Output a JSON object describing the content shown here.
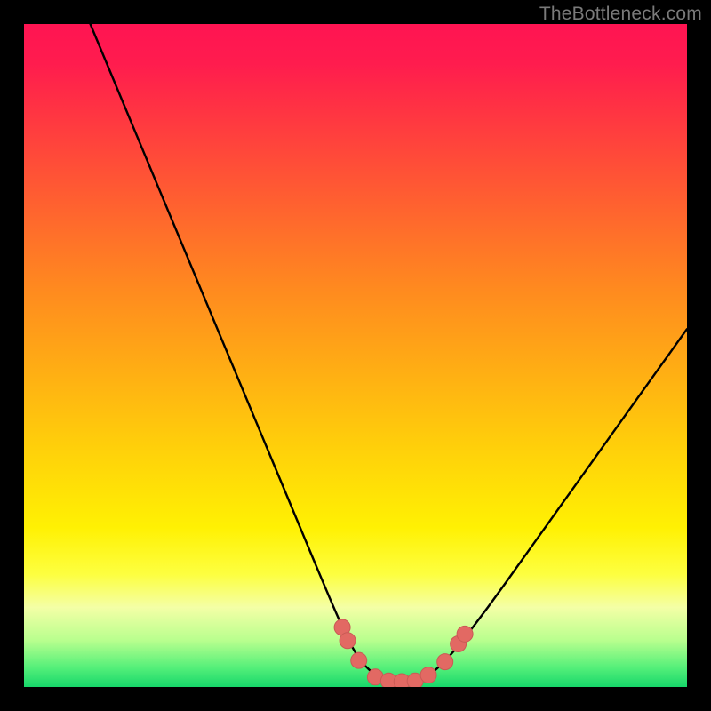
{
  "watermark": "TheBottleneck.com",
  "colors": {
    "frame": "#000000",
    "curve": "#000000",
    "pointFill": "#e26963",
    "pointStroke": "#c95a55",
    "gradientStops": [
      "#ff1452",
      "#ff1c4e",
      "#ff3044",
      "#ff4a39",
      "#ff6a2c",
      "#ff8a1f",
      "#ffad14",
      "#ffd00a",
      "#fff103",
      "#fdff40",
      "#f4ffa6",
      "#b8ff8e",
      "#56f07a",
      "#17d76a"
    ]
  },
  "chart_data": {
    "type": "line",
    "title": "",
    "xlabel": "",
    "ylabel": "",
    "xlim": [
      0,
      100
    ],
    "ylim": [
      0,
      100
    ],
    "grid": false,
    "series": [
      {
        "name": "bottleneck-curve",
        "x": [
          10,
          15,
          20,
          25,
          30,
          35,
          40,
          45,
          48,
          50,
          52,
          54,
          56,
          58,
          60,
          62,
          65,
          70,
          75,
          80,
          85,
          90,
          95,
          100
        ],
        "y": [
          100,
          88,
          76,
          64,
          52,
          40,
          28,
          16,
          9,
          5,
          2.5,
          1.3,
          0.8,
          0.8,
          1.2,
          2.4,
          5.5,
          12,
          19,
          26,
          33,
          40,
          47,
          54
        ]
      }
    ],
    "points": [
      {
        "x": 48.0,
        "y": 9.0
      },
      {
        "x": 48.8,
        "y": 7.0
      },
      {
        "x": 50.5,
        "y": 4.0
      },
      {
        "x": 53.0,
        "y": 1.5
      },
      {
        "x": 55.0,
        "y": 0.9
      },
      {
        "x": 57.0,
        "y": 0.8
      },
      {
        "x": 59.0,
        "y": 0.9
      },
      {
        "x": 61.0,
        "y": 1.8
      },
      {
        "x": 63.5,
        "y": 3.8
      },
      {
        "x": 65.5,
        "y": 6.5
      },
      {
        "x": 66.5,
        "y": 8.0
      }
    ]
  }
}
